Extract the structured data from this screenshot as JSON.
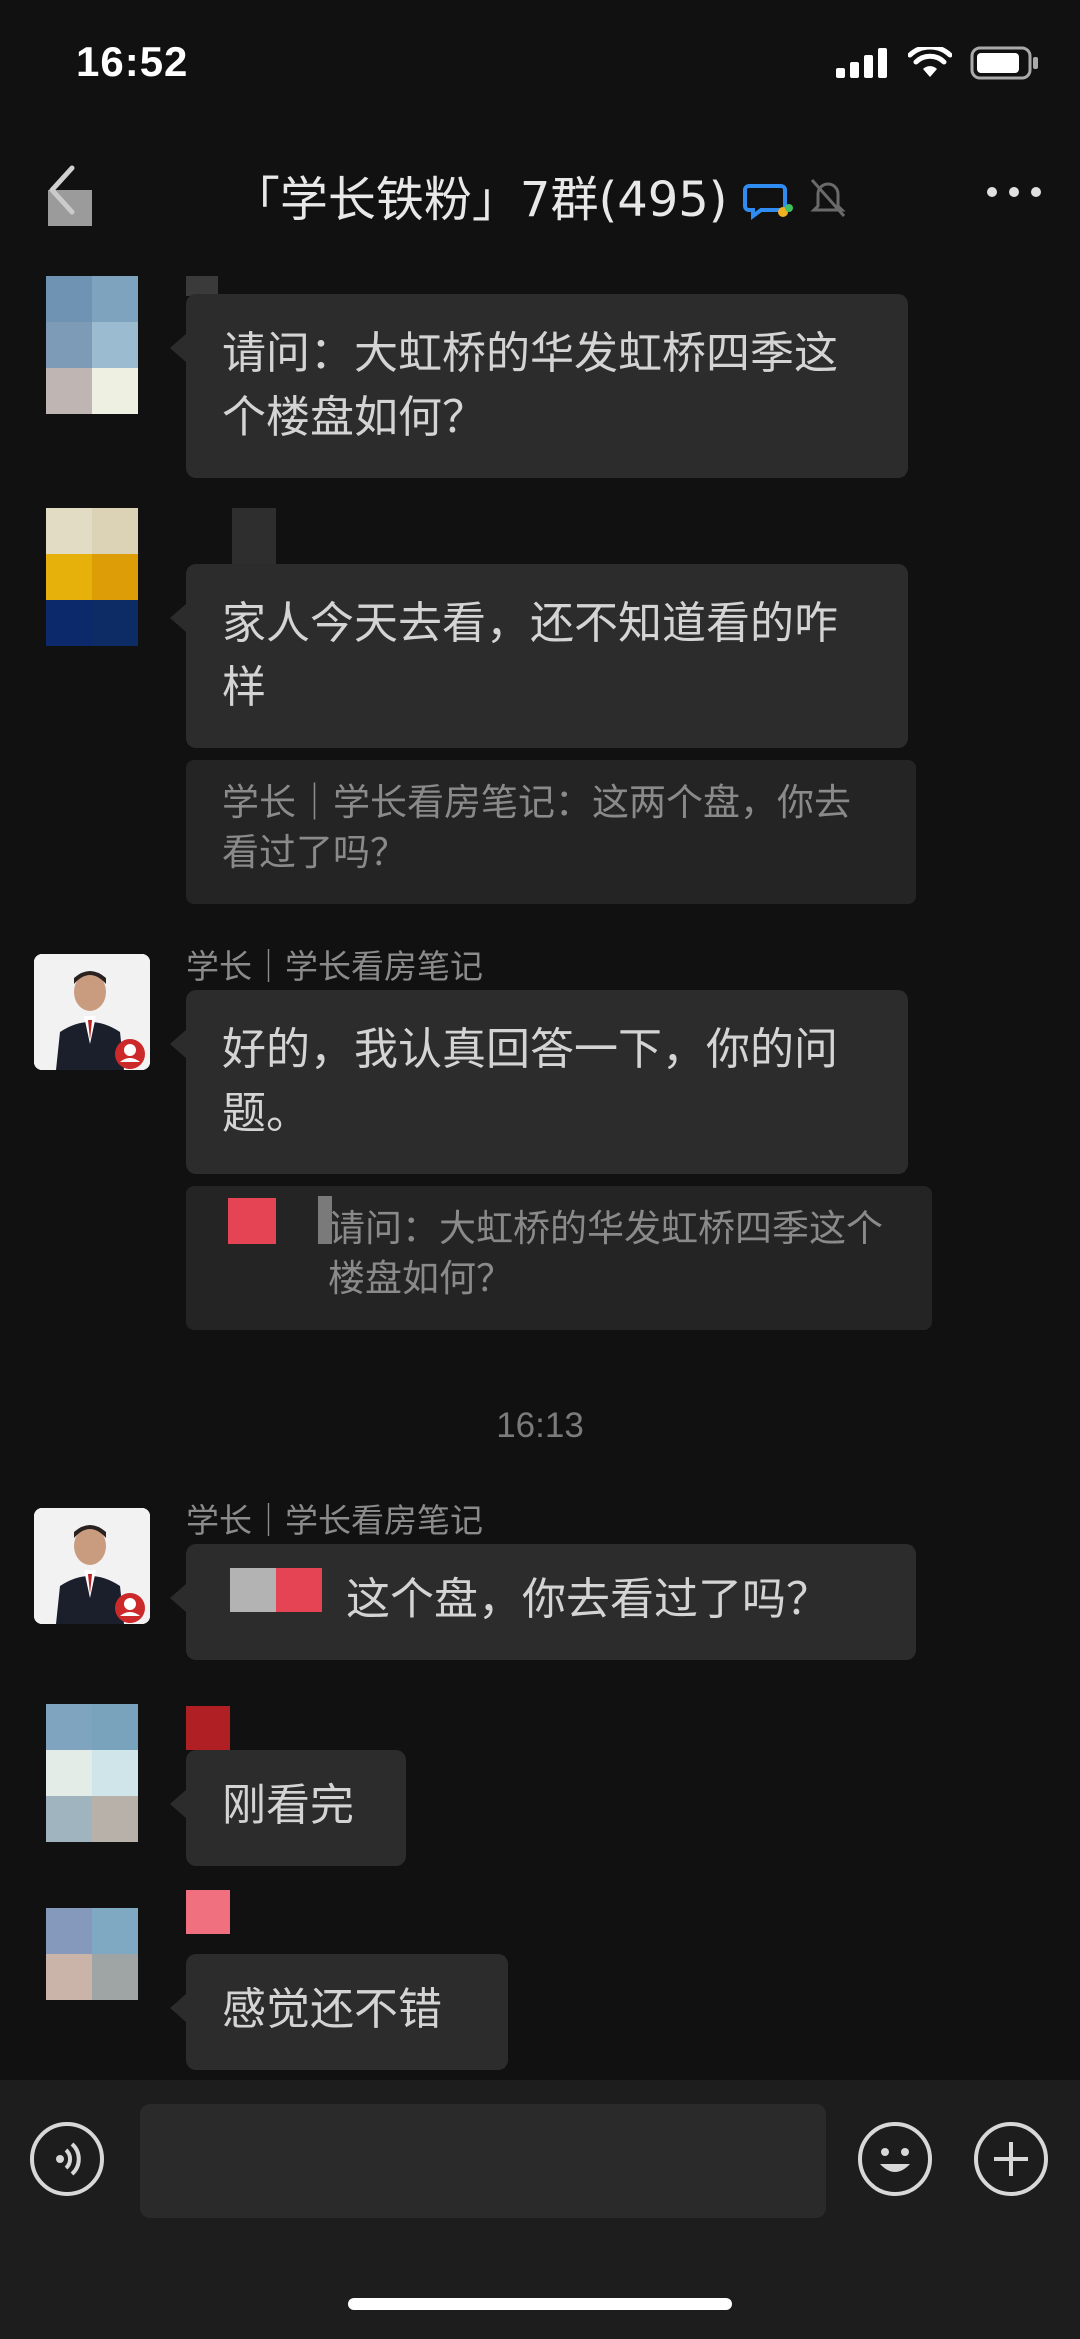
{
  "status_bar": {
    "time": "16:52"
  },
  "header": {
    "title": "「学长铁粉」7群(495)",
    "back_label": "<",
    "more_label": "•••"
  },
  "messages": [
    {
      "text": "请问：大虹桥的华发虹桥四季这个楼盘如何？"
    },
    {
      "text": "家人今天去看，还不知道看的咋样"
    },
    {
      "quote": "学长｜学长看房笔记：这两个盘，你去看过了吗？"
    },
    {
      "sender": "学长｜学长看房笔记",
      "text": "好的，我认真回答一下，你的问题。"
    },
    {
      "quote": "请问：大虹桥的华发虹桥四季这个楼盘如何？"
    },
    {
      "sender": "学长｜学长看房笔记",
      "text": "这个盘，你去看过了吗？"
    },
    {
      "text": "刚看完"
    },
    {
      "text": "感觉还不错"
    }
  ],
  "timestamp": "16:13",
  "colors": {
    "background": "#111111",
    "bubble": "#2c2c2c",
    "accent_red": "#e44453",
    "status_icon": "#ffffff"
  },
  "icons": {
    "signal": "signal-icon",
    "wifi": "wifi-icon",
    "battery": "battery-icon",
    "voice": "voice-icon",
    "emoji": "emoji-icon",
    "add": "add-icon",
    "mute": "bell-off-icon",
    "group": "group-chat-icon"
  }
}
